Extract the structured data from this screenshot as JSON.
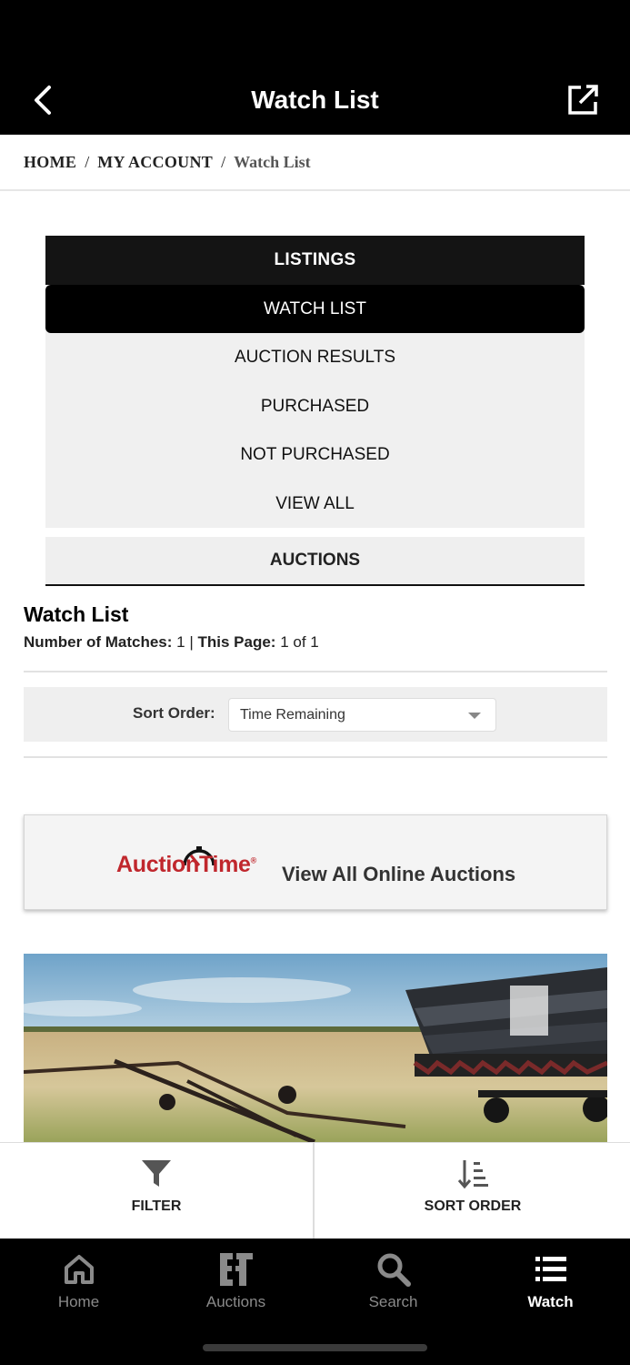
{
  "header": {
    "title": "Watch List"
  },
  "breadcrumb": {
    "home": "HOME",
    "account": "MY ACCOUNT",
    "current": "Watch List"
  },
  "menu": {
    "listings_label": "LISTINGS",
    "items": [
      "WATCH LIST",
      "AUCTION RESULTS",
      "PURCHASED",
      "NOT PURCHASED",
      "VIEW ALL"
    ],
    "active_item": "WATCH LIST",
    "auctions_label": "AUCTIONS"
  },
  "watchlist": {
    "title": "Watch List",
    "matches_label": "Number of Matches:",
    "matches_value": "1 |",
    "page_label": "This Page:",
    "page_value": "1 of 1"
  },
  "sort": {
    "label": "Sort Order:",
    "selected": "Time Remaining"
  },
  "banner": {
    "logo": "AuctionTime",
    "logo_tm": "®",
    "text": "View All Online Auctions"
  },
  "actions": {
    "filter": "FILTER",
    "sort_order": "SORT ORDER"
  },
  "tabs": [
    {
      "label": "Home",
      "icon": "home-icon"
    },
    {
      "label": "Auctions",
      "icon": "auctions-icon"
    },
    {
      "label": "Search",
      "icon": "search-icon"
    },
    {
      "label": "Watch",
      "icon": "list-icon"
    }
  ],
  "active_tab": "Watch",
  "colors": {
    "accent": "#000000",
    "brand_red": "#c0272d",
    "inactive_tab": "#8a8a8a"
  }
}
